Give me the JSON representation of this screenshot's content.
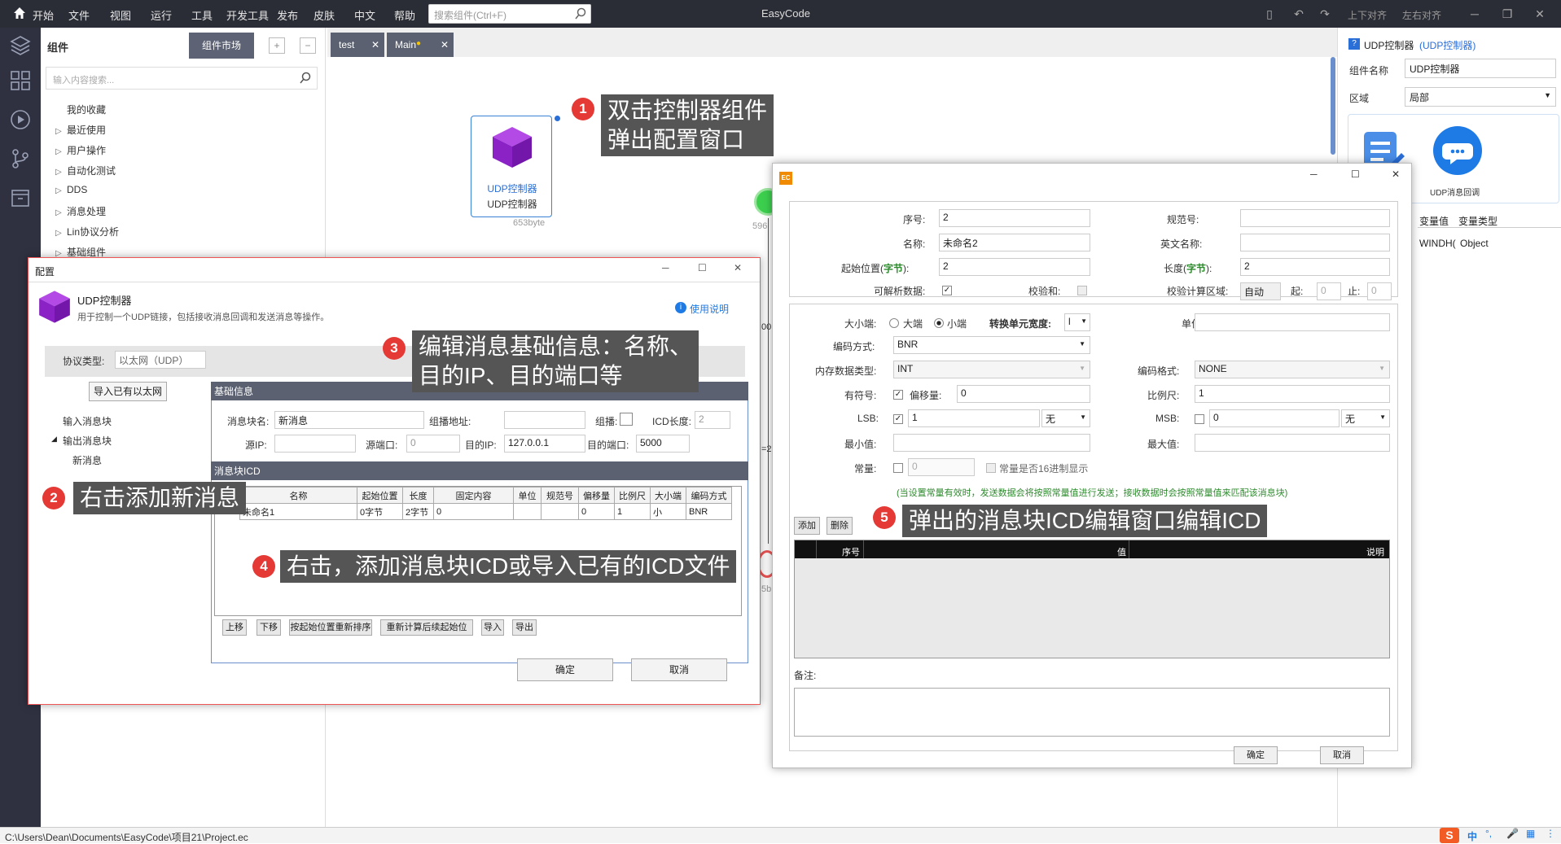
{
  "menu": {
    "start": "开始",
    "items": [
      "文件",
      "视图",
      "运行",
      "工具",
      "开发工具",
      "发布",
      "皮肤",
      "中文",
      "帮助"
    ],
    "search_placeholder": "搜索组件(Ctrl+F)",
    "app_title": "EasyCode",
    "align_top_bottom": "上下对齐",
    "align_left_right": "左右对齐"
  },
  "sidebar": {
    "title": "组件",
    "market_button": "组件市场",
    "search_placeholder": "输入内容搜索...",
    "tree": [
      "我的收藏",
      "最近使用",
      "用户操作",
      "自动化测试",
      "DDS",
      "消息处理",
      "Lin协议分析",
      "基础组件"
    ]
  },
  "tabs": [
    {
      "label": "test"
    },
    {
      "label": "Main"
    }
  ],
  "canvas": {
    "node_label1": "UDP控制器",
    "node_label2": "UDP控制器",
    "node_size": "653byte",
    "partial_labels": [
      "596",
      "00",
      "=2",
      "5b"
    ]
  },
  "callouts": {
    "c1_num": "1",
    "c1_line1": "双击控制器组件",
    "c1_line2": "弹出配置窗口",
    "c2_num": "2",
    "c2_text": "右击添加新消息",
    "c3_num": "3",
    "c3_line1": "编辑消息基础信息：名称、",
    "c3_line2": "目的IP、目的端口等",
    "c4_num": "4",
    "c4_text": "右击，添加消息块ICD或导入已有的ICD文件",
    "c5_num": "5",
    "c5_text": "弹出的消息块ICD编辑窗口编辑ICD"
  },
  "props": {
    "title": "UDP控制器",
    "title_sub": "(UDP控制器)",
    "name_label": "组件名称",
    "name_value": "UDP控制器",
    "scope_label": "区域",
    "scope_value": "局部",
    "icon2_label": "UDP消息回调",
    "col_value": "变量值",
    "col_type": "变量类型",
    "row_value": "WINDH(",
    "row_type": "Object"
  },
  "config": {
    "title": "配置",
    "heading": "UDP控制器",
    "desc": "用于控制一个UDP链接，包括接收消息回调和发送消息等操作。",
    "help": "使用说明",
    "protocol_label": "协议类型:",
    "protocol_value": "以太网（UDP）",
    "import_btn": "导入已有以太网",
    "tree_in": "输入消息块",
    "tree_out": "输出消息块",
    "tree_new": "新消息",
    "basic_section": "基础信息",
    "block_name_label": "消息块名:",
    "block_name_value": "新消息",
    "multicast_label": "组播地址:",
    "group_label": "组播:",
    "icd_len_label": "ICD长度:",
    "icd_len_value": "2",
    "src_ip_label": "源IP:",
    "src_port_label": "源端口:",
    "src_port_value": "0",
    "dst_ip_label": "目的IP:",
    "dst_ip_value": "127.0.0.1",
    "dst_port_label": "目的端口:",
    "dst_port_value": "5000",
    "icd_section": "消息块ICD",
    "table_headers": [
      "名称",
      "起始位置",
      "长度",
      "固定内容",
      "单位",
      "规范号",
      "偏移量",
      "比例尺",
      "大小端",
      "编码方式"
    ],
    "table_row": [
      "未命名1",
      "0字节",
      "2字节",
      "0",
      "",
      "",
      "0",
      "1",
      "小",
      "BNR"
    ],
    "row_index": "1",
    "buttons": [
      "上移",
      "下移",
      "按起始位置重新排序",
      "重新计算后续起始位",
      "导入",
      "导出"
    ],
    "ok": "确定",
    "cancel": "取消"
  },
  "icd_dlg": {
    "seq_label": "序号:",
    "seq_value": "2",
    "spec_label": "规范号:",
    "name_label": "名称:",
    "name_value": "未命名2",
    "en_name_label": "英文名称:",
    "start_label": "起始位置(",
    "unit_byte": "字节",
    "close_paren": "):",
    "start_value": "2",
    "len_label": "长度(",
    "len_value": "2",
    "parsable_label": "可解析数据:",
    "checksum_label": "校验和:",
    "checksum_area_label": "校验计算区域:",
    "checksum_area_value": "自动",
    "from_label": "起:",
    "from_value": "0",
    "to_label": "止:",
    "to_value": "0",
    "endian_label": "大小端:",
    "big_endian": "大端",
    "little_endian": "小端",
    "conv_width_label": "转换单元宽度:",
    "conv_width_value": "l",
    "unit_label": "单位:",
    "enc_label": "编码方式:",
    "enc_value": "BNR",
    "mem_type_label": "内存数据类型:",
    "mem_type_value": "INT",
    "enc_format_label": "编码格式:",
    "enc_format_value": "NONE",
    "signed_label": "有符号:",
    "offset_label": "偏移量:",
    "offset_value": "0",
    "scale_label": "比例尺:",
    "scale_value": "1",
    "lsb_label": "LSB:",
    "lsb_value": "1",
    "lsb_unit": "无",
    "msb_label": "MSB:",
    "msb_value": "0",
    "msb_unit": "无",
    "min_label": "最小值:",
    "max_label": "最大值:",
    "const_label": "常量:",
    "const_value": "0",
    "const_hex_label": "常量是否16进制显示",
    "hint": "(当设置常量有效时，发送数据会将按照常量值进行发送；接收数据时会按照常量值来匹配该消息块)",
    "add_btn": "添加",
    "del_btn": "删除",
    "grid_headers": [
      "序号",
      "值",
      "说明"
    ],
    "remark_label": "备注:",
    "ok": "确定",
    "cancel": "取消"
  },
  "status": {
    "path": "C:\\Users\\Dean\\Documents\\EasyCode\\项目21\\Project.ec",
    "ime": "中"
  },
  "colors": {
    "accent": "#3a82d6",
    "cube": "#9b2fd6",
    "callout_bg": "#555555",
    "badge": "#e53935"
  }
}
